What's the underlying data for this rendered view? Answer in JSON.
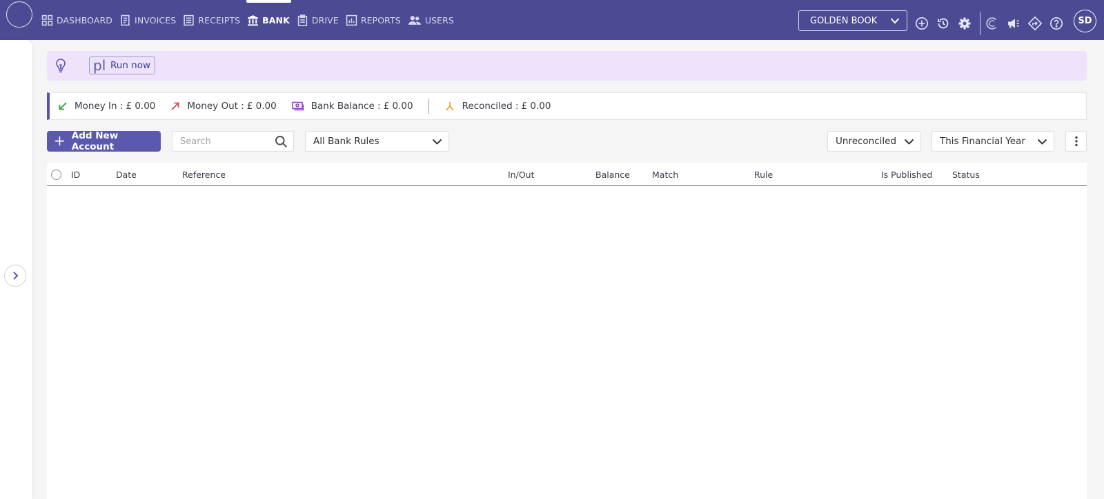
{
  "nav": {
    "items": [
      {
        "label": "DASHBOARD",
        "icon": "grid-icon"
      },
      {
        "label": "INVOICES",
        "icon": "invoice-icon"
      },
      {
        "label": "RECEIPTS",
        "icon": "receipt-icon"
      },
      {
        "label": "BANK",
        "icon": "bank-icon",
        "active": true
      },
      {
        "label": "DRIVE",
        "icon": "clipboard-icon"
      },
      {
        "label": "REPORTS",
        "icon": "chart-icon"
      },
      {
        "label": "USERS",
        "icon": "users-icon"
      }
    ]
  },
  "company_selector": {
    "value": "GOLDEN BOOK"
  },
  "user": {
    "initials": "SD"
  },
  "tip": {
    "code_fragment": "pl",
    "run_label": "Run now"
  },
  "summary": {
    "money_in": {
      "label": "Money In :",
      "value": "£ 0.00"
    },
    "money_out": {
      "label": "Money Out :",
      "value": "£ 0.00"
    },
    "bank_balance": {
      "label": "Bank Balance :",
      "value": "£ 0.00"
    },
    "reconciled": {
      "label": "Reconciled :",
      "value": "£ 0.00"
    }
  },
  "toolbar": {
    "add_account_label": "Add New Account",
    "search_placeholder": "Search",
    "rules_filter": "All Bank Rules",
    "status_filter": "Unreconciled",
    "period_filter": "This Financial Year"
  },
  "table": {
    "columns": [
      "ID",
      "Date",
      "Reference",
      "In/Out",
      "Balance",
      "Match",
      "Rule",
      "Is Published",
      "Status"
    ],
    "rows": []
  },
  "colors": {
    "topbar": "#4b4a93",
    "accent": "#5b59ad",
    "tip_background": "#eee3fb",
    "money_in": "#2e9c3a",
    "money_out": "#d9353a",
    "bank_balance": "#9a3fd0",
    "reconciled": "#f2a530"
  }
}
